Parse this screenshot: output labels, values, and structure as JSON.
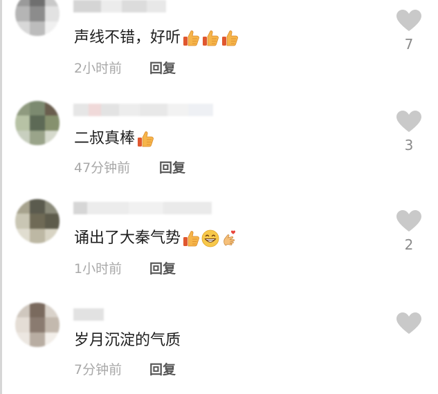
{
  "comments": [
    {
      "text": "声线不错，好听",
      "time": "2小时前",
      "reply_label": "回复",
      "likes": "7",
      "emoji": [
        "thumbs-up-icon",
        "thumbs-up-icon",
        "thumbs-up-icon"
      ],
      "avatar_colors": [
        "#9a9a9a",
        "#6f6f6f",
        "#c9c9c9",
        "#b5b5b5",
        "#8c8c8c",
        "#e2e2e2",
        "#d8d8d8",
        "#bcbcbc",
        "#f0f0f0"
      ]
    },
    {
      "text": "二叔真棒",
      "time": "47分钟前",
      "reply_label": "回复",
      "likes": "3",
      "emoji": [
        "thumbs-up-icon"
      ],
      "avatar_colors": [
        "#8f9a7f",
        "#7c8a70",
        "#6a5e4e",
        "#b7c2a5",
        "#5d6a56",
        "#86916e",
        "#c8cfbf",
        "#9aa48a",
        "#d6dacd"
      ]
    },
    {
      "text": "诵出了大秦气势",
      "time": "1小时前",
      "reply_label": "回复",
      "likes": "2",
      "emoji": [
        "thumbs-up-icon",
        "grinning-face-icon",
        "finger-heart-icon"
      ],
      "avatar_colors": [
        "#a7a38e",
        "#5b5b4e",
        "#8b8b7a",
        "#c9c6b4",
        "#6f6a56",
        "#5e5c4c",
        "#e0ddd0",
        "#bdb8a4",
        "#d8d4c4"
      ]
    },
    {
      "text": "岁月沉淀的气质",
      "time": "7分钟前",
      "reply_label": "回复",
      "likes": "",
      "emoji": [],
      "avatar_colors": [
        "#cfc7be",
        "#7a6a5e",
        "#d9d2ca",
        "#e4ddd5",
        "#8a7b70",
        "#c3b9ae",
        "#ece7e1",
        "#b8ada2",
        "#f2eee9"
      ]
    }
  ],
  "colors": {
    "heart": "#c9c9c9",
    "meta": "#a8a8a8",
    "reply": "#555555",
    "text": "#1e1e1e"
  }
}
